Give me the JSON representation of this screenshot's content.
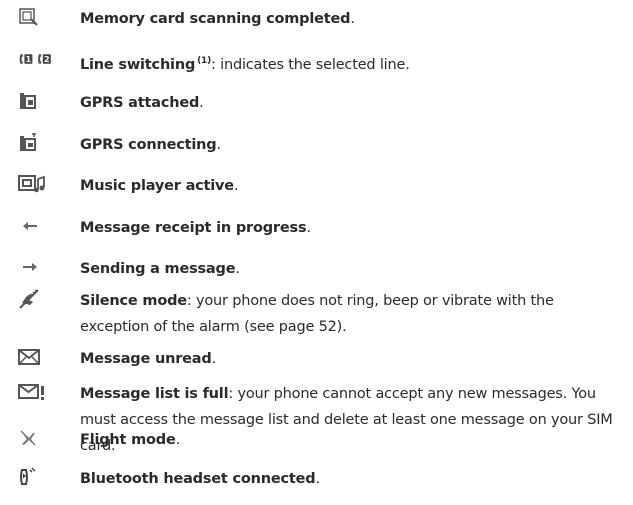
{
  "items": [
    {
      "icon": "memory-card-scan-icon",
      "term": "Memory card scanning completed",
      "rest": "."
    },
    {
      "icon": "line-switching-icon",
      "term": "Line switching",
      "sup": "(1)",
      "rest": ": indicates the selected line."
    },
    {
      "icon": "gprs-attached-icon",
      "term": "GPRS attached",
      "rest": "."
    },
    {
      "icon": "gprs-connecting-icon",
      "term": "GPRS connecting",
      "rest": "."
    },
    {
      "icon": "music-player-icon",
      "term": "Music player active",
      "rest": "."
    },
    {
      "icon": "arrow-left-icon",
      "term": "Message receipt in progress",
      "rest": "."
    },
    {
      "icon": "arrow-right-icon",
      "term": "Sending a message",
      "rest": "."
    },
    {
      "icon": "silence-mode-icon",
      "term": "Silence mode",
      "rest": ": your phone does not ring, beep or vibrate with the exception of the alarm (see page 52)."
    },
    {
      "icon": "envelope-icon",
      "term": "Message unread",
      "rest": "."
    },
    {
      "icon": "envelope-full-icon",
      "term": "Message list is full",
      "rest": ": your phone cannot accept any new messages. You must access the message list and delete at least one message on your SIM card."
    },
    {
      "icon": "flight-mode-icon",
      "term": "Flight mode",
      "rest": "."
    },
    {
      "icon": "bluetooth-headset-icon",
      "term": "Bluetooth headset connected",
      "rest": "."
    }
  ]
}
